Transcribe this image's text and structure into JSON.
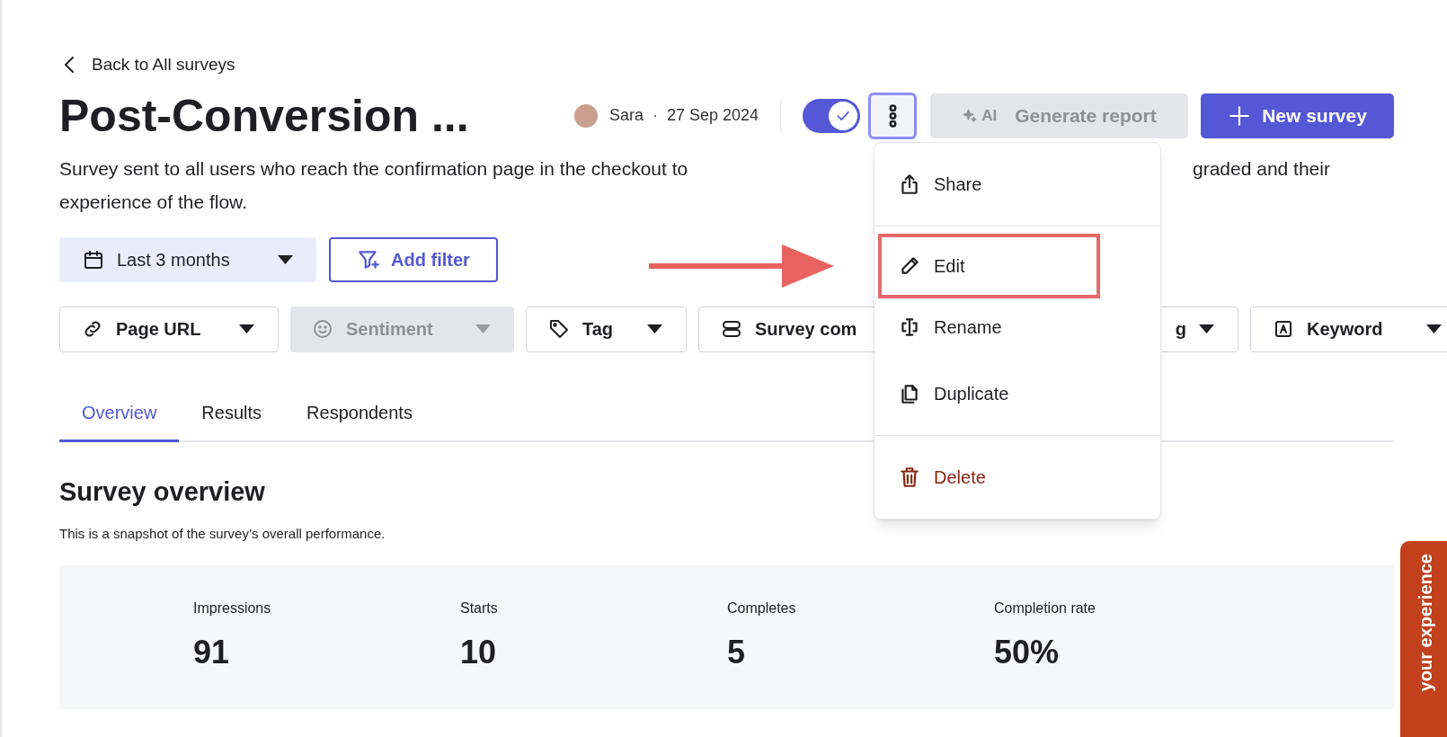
{
  "back_link": "Back to All surveys",
  "title": "Post-Conversion ...",
  "meta": {
    "author": "Sara",
    "separator": "·",
    "date": "27 Sep 2024"
  },
  "status_toggle": {
    "on": true
  },
  "more_button": {
    "focused": true
  },
  "generate_report": {
    "badge": "AI",
    "label": "Generate report",
    "disabled": true
  },
  "new_survey": "New survey",
  "description": {
    "line_1_start": "Survey sent to all users who reach the confirmation page in the checkout to",
    "line_1_end": "graded and their",
    "line_2": "experience of the flow."
  },
  "date_filter": "Last 3 months",
  "add_filter": "Add filter",
  "filter_chips": [
    {
      "label": "Page URL",
      "disabled": false
    },
    {
      "label": "Sentiment",
      "disabled": true
    },
    {
      "label": "Tag",
      "disabled": false
    },
    {
      "label": "Survey com",
      "disabled": false
    },
    {
      "label": "g",
      "disabled": false
    },
    {
      "label": "Keyword",
      "disabled": false
    }
  ],
  "tabs": [
    {
      "label": "Overview",
      "selected": true
    },
    {
      "label": "Results",
      "selected": false
    },
    {
      "label": "Respondents",
      "selected": false
    }
  ],
  "overview": {
    "heading": "Survey overview",
    "subheading": "This is a snapshot of the survey’s overall performance.",
    "stats": [
      {
        "label": "Impressions",
        "value": "91"
      },
      {
        "label": "Starts",
        "value": "10"
      },
      {
        "label": "Completes",
        "value": "5"
      },
      {
        "label": "Completion rate",
        "value": "50%"
      }
    ]
  },
  "menu": {
    "sections": [
      [
        {
          "label": "Share",
          "kind": "normal",
          "highlighted": false
        }
      ],
      [
        {
          "label": "Edit",
          "kind": "normal",
          "highlighted": true
        },
        {
          "label": "Rename",
          "kind": "normal",
          "highlighted": false
        },
        {
          "label": "Duplicate",
          "kind": "normal",
          "highlighted": false
        }
      ],
      [
        {
          "label": "Delete",
          "kind": "danger",
          "highlighted": false
        }
      ]
    ]
  },
  "feedback_tab": "your experience"
}
